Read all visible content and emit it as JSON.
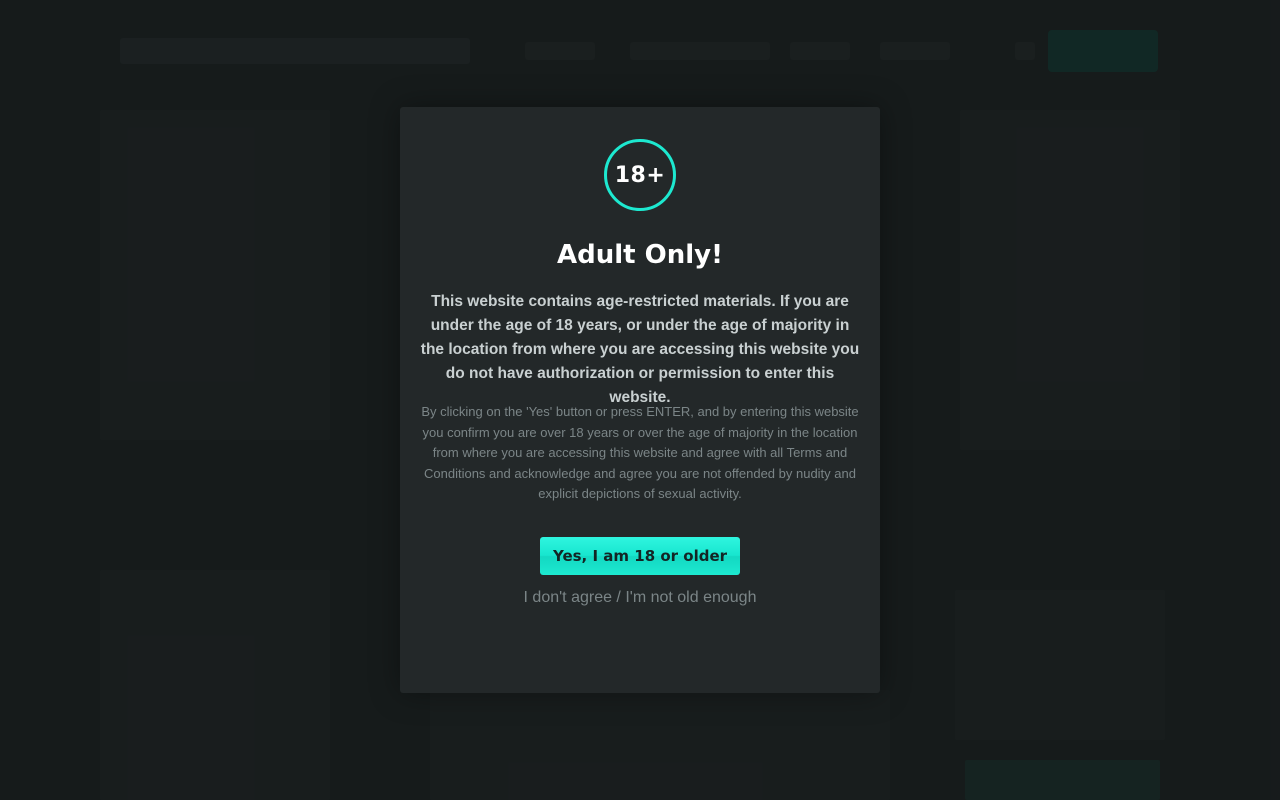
{
  "modal": {
    "badge": "18+",
    "title": "Adult Only!",
    "lead": "This website contains age-restricted materials. If you are under the age of 18 years, or under the age of majority in the location from where you are accessing this website you do not have authorization or permission to enter this website.",
    "fine_print": "By clicking on the 'Yes' button or press ENTER, and by entering this website you confirm you are over 18 years or over the age of majority in the location from where you are accessing this website and agree with all Terms and Conditions and acknowledge and agree you are not offended by nudity and explicit depictions of sexual activity.",
    "confirm_label": "Yes, I am 18 or older",
    "decline_label": "I don't agree / I'm not old enough"
  },
  "colors": {
    "accent": "#1de9d0",
    "modal_bg": "#232829",
    "page_bg": "#1c2122"
  },
  "icons": {
    "badge": "age-18-plus-badge-icon"
  }
}
